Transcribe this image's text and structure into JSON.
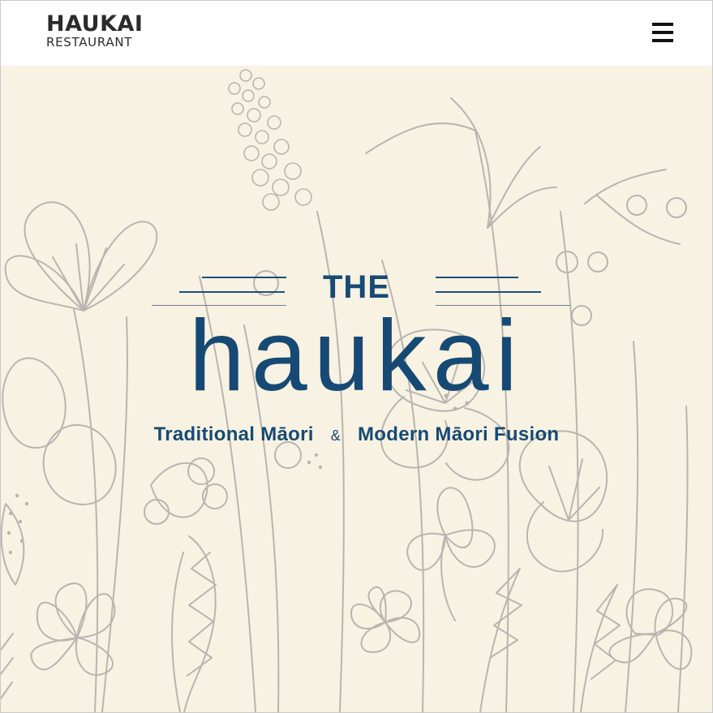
{
  "header": {
    "brand": {
      "title": "HAUKAI",
      "subtitle": "RESTAURANT"
    },
    "menu_icon": "hamburger-menu-icon"
  },
  "hero": {
    "the": "THE",
    "name": "haukai",
    "tagline": {
      "left": "Traditional Māori",
      "ampersand": "&",
      "right": "Modern Māori Fusion"
    }
  },
  "colors": {
    "brand_blue": "#164a74",
    "hero_background": "#f8f2e3",
    "line_art": "#b8b5b0"
  }
}
